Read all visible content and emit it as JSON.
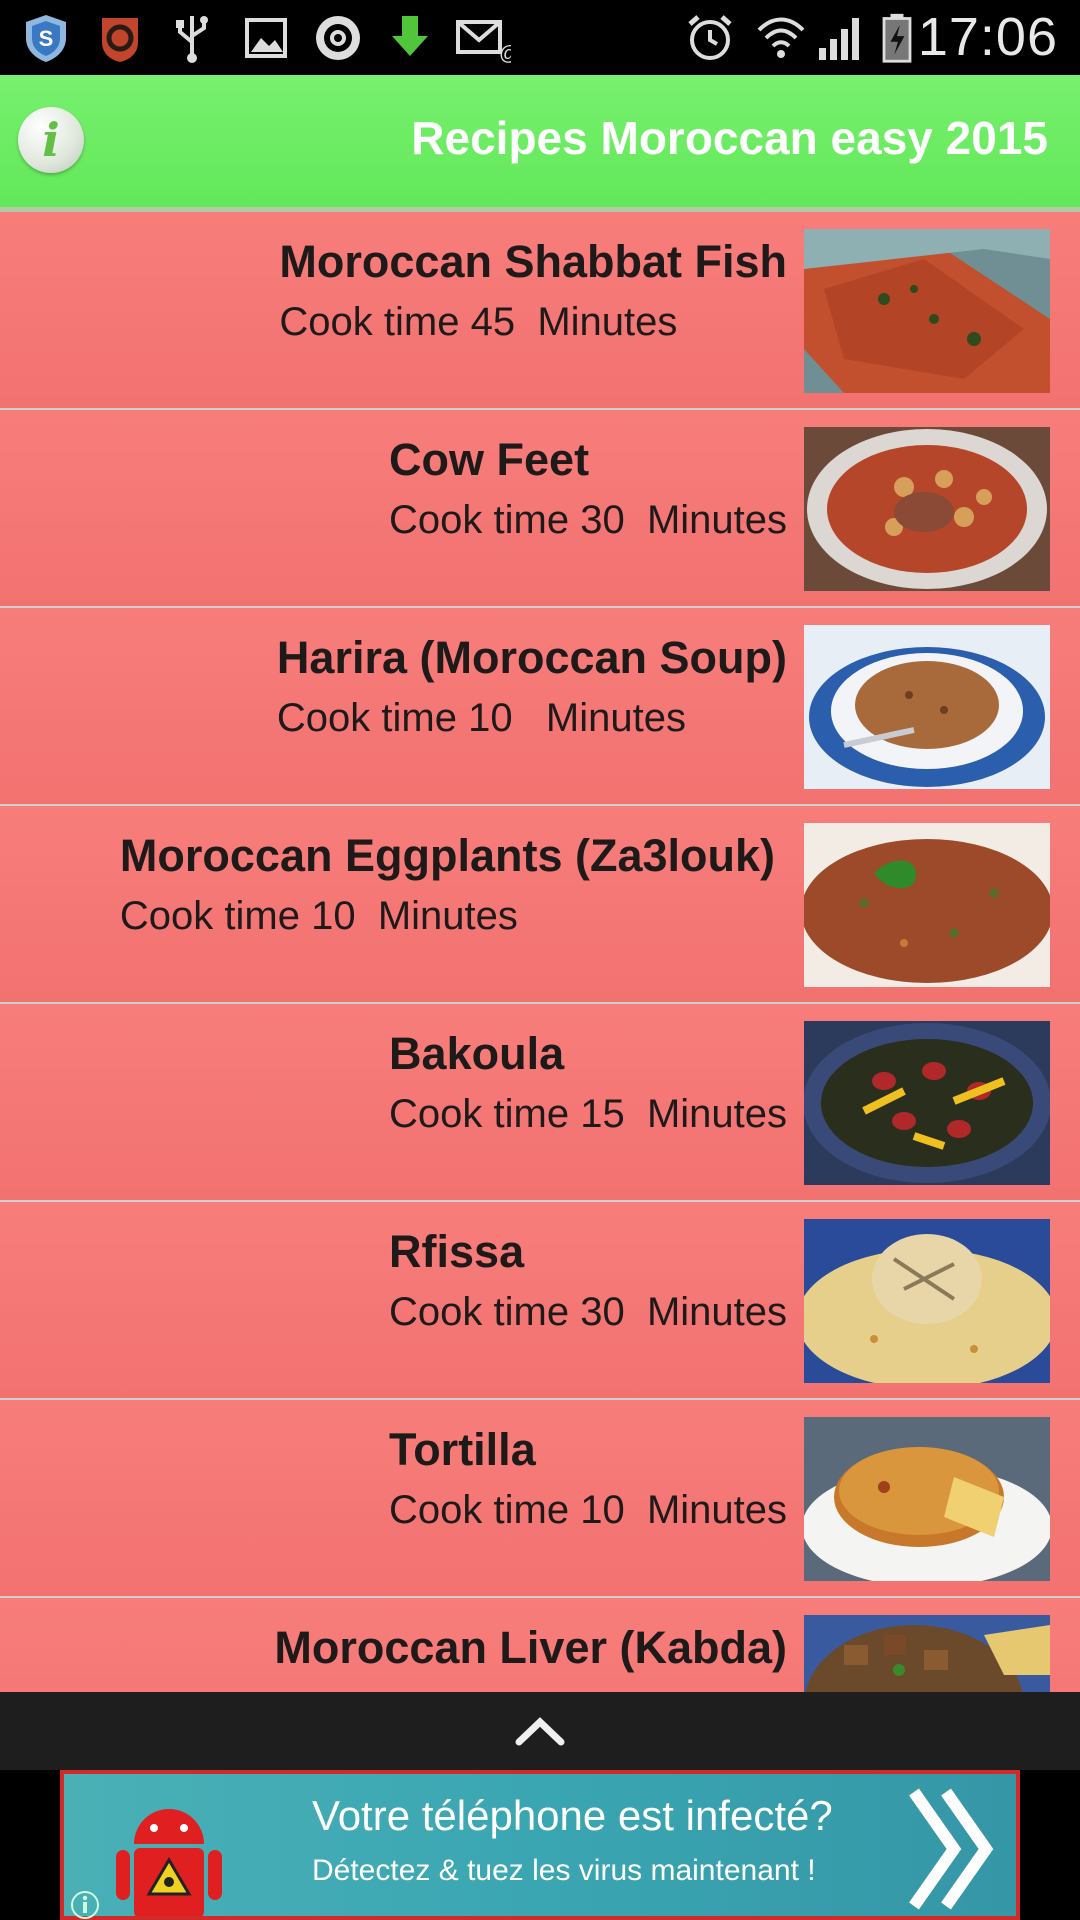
{
  "status_bar": {
    "time": "17:06",
    "icons": [
      "shield-icon",
      "security-app-icon",
      "usb-icon",
      "image-icon",
      "sync-icon",
      "download-icon",
      "email-icon",
      "alarm-icon",
      "wifi-icon",
      "signal-icon",
      "battery-icon"
    ]
  },
  "header": {
    "info_glyph": "i",
    "title": "Recipes Moroccan easy 2015",
    "color": "#66ea5e"
  },
  "recipes": [
    {
      "title": "Moroccan Shabbat Fish",
      "cook_time": "Cook time 45  Minutes",
      "image": "fish-photo"
    },
    {
      "title": "Cow Feet",
      "cook_time": "Cook time 30  Minutes",
      "image": "stew-photo"
    },
    {
      "title": "Harira (Moroccan Soup)",
      "cook_time": "Cook time 10   Minutes",
      "image": "soup-photo"
    },
    {
      "title": "Moroccan Eggplants (Za3louk)",
      "cook_time": "Cook time 10  Minutes",
      "image": "eggplant-photo"
    },
    {
      "title": "Bakoula",
      "cook_time": "Cook time 15  Minutes",
      "image": "bakoula-photo"
    },
    {
      "title": "Rfissa",
      "cook_time": "Cook time 30  Minutes",
      "image": "rfissa-photo"
    },
    {
      "title": "Tortilla",
      "cook_time": "Cook time 10  Minutes",
      "image": "tortilla-photo"
    },
    {
      "title": "Moroccan Liver (Kabda)",
      "cook_time": "",
      "image": "liver-photo"
    }
  ],
  "bottom_bar": {
    "icon": "chevron-up-icon"
  },
  "ad": {
    "line1": "Votre téléphone est infecté?",
    "line2": "Détectez & tuez les virus maintenant !",
    "border_color": "#d12a2a"
  },
  "colors": {
    "row_bg": "#f47775",
    "header_bg": "#66ea5e"
  }
}
